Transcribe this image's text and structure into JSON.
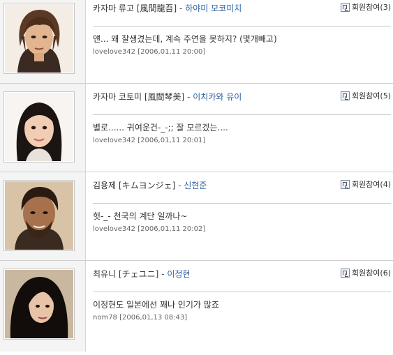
{
  "entries": [
    {
      "character": "카자마 류고 [風間龍吾]",
      "separator": "-",
      "actor": "하야미 모코미치",
      "join_label": "회원참여(3)",
      "comment": "얜... 왜 잘생겼는데, 계속 주연을 못하지? (몇개빼고)",
      "meta": "lovelove342 [2006,01,11 20:00]",
      "photo_icon": "portrait-man-long-hair"
    },
    {
      "character": "카자마 코토미 [風間琴美]",
      "separator": "-",
      "actor": "이치카와 유이",
      "join_label": "회원참여(5)",
      "comment": "별로...... 귀여운건-_-;; 잘 모르겠는....",
      "meta": "lovelove342 [2006,01,11 20:01]",
      "photo_icon": "portrait-young-woman"
    },
    {
      "character": "김용제 [キムヨンジェ]",
      "separator": "-",
      "actor": "신현준",
      "join_label": "회원참여(4)",
      "comment": "헛-_- 천국의 계단 일까나~",
      "meta": "lovelove342 [2006,01,11 20:02]",
      "photo_icon": "portrait-man-beard"
    },
    {
      "character": "최유니 [チェユニ]",
      "separator": "-",
      "actor": "이정현",
      "join_label": "회원참여(6)",
      "comment": "이정현도 일본에선 꽤나 인기가 많죠",
      "meta": "nom78 [2006,01,13 08:43]",
      "photo_icon": "portrait-woman-dark-hair"
    }
  ]
}
